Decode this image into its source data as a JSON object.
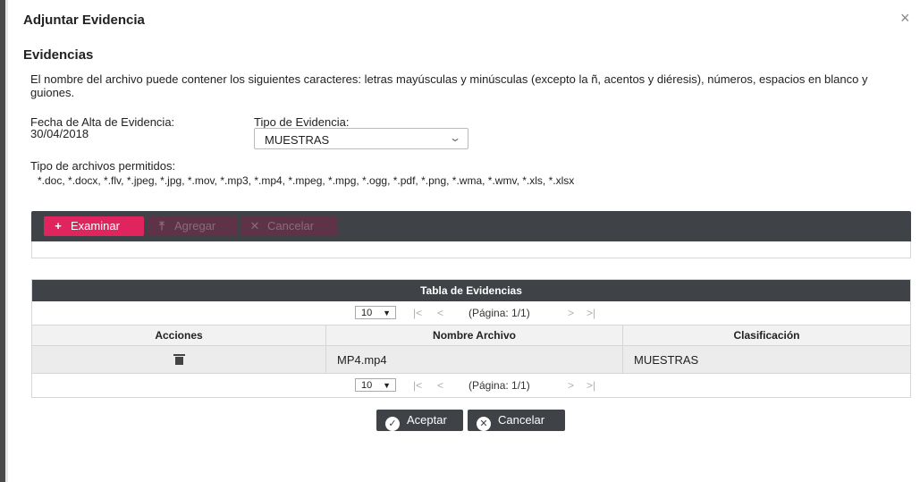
{
  "dialog": {
    "title": "Adjuntar Evidencia",
    "close_icon": "×"
  },
  "section": {
    "title": "Evidencias"
  },
  "note": "El nombre del archivo puede contener los siguientes caracteres: letras mayúsculas y minúsculas (excepto la ñ, acentos y diéresis), números, espacios en blanco y guiones.",
  "fecha": {
    "label": "Fecha de Alta de Evidencia:",
    "value": "30/04/2018"
  },
  "tipo": {
    "label": "Tipo de Evidencia:",
    "selected": "MUESTRAS",
    "chevron": "⌄"
  },
  "tipos_archivo": {
    "label": "Tipo de archivos permitidos:",
    "value": "*.doc, *.docx, *.flv, *.jpeg, *.jpg, *.mov, *.mp3, *.mp4, *.mpeg, *.mpg, *.ogg, *.pdf, *.png, *.wma, *.wmv, *.xls, *.xlsx"
  },
  "uploader": {
    "examinar": {
      "label": "Examinar",
      "icon": "+"
    },
    "agregar": {
      "label": "Agregar",
      "icon": "⤒"
    },
    "cancelar": {
      "label": "Cancelar",
      "icon": "✕"
    },
    "accent": "#e0245e",
    "bar_color": "#3f4246"
  },
  "table": {
    "caption": "Tabla de Evidencias",
    "pager_top": {
      "rows": "10",
      "first": "|<",
      "prev": "<",
      "page": "(Página: 1/1)",
      "next": ">",
      "last": ">|"
    },
    "pager_bottom": {
      "rows": "10",
      "first": "|<",
      "prev": "<",
      "page": "(Página: 1/1)",
      "next": ">",
      "last": ">|"
    },
    "headers": [
      "Acciones",
      "Nombre Archivo",
      "Clasificación"
    ],
    "rows": [
      {
        "nombre": "MP4.mp4",
        "clasificacion": "MUESTRAS"
      }
    ]
  },
  "footer": {
    "aceptar": {
      "label": "Aceptar",
      "icon": "✓"
    },
    "cancelar": {
      "label": "Cancelar",
      "icon": "✕"
    }
  }
}
